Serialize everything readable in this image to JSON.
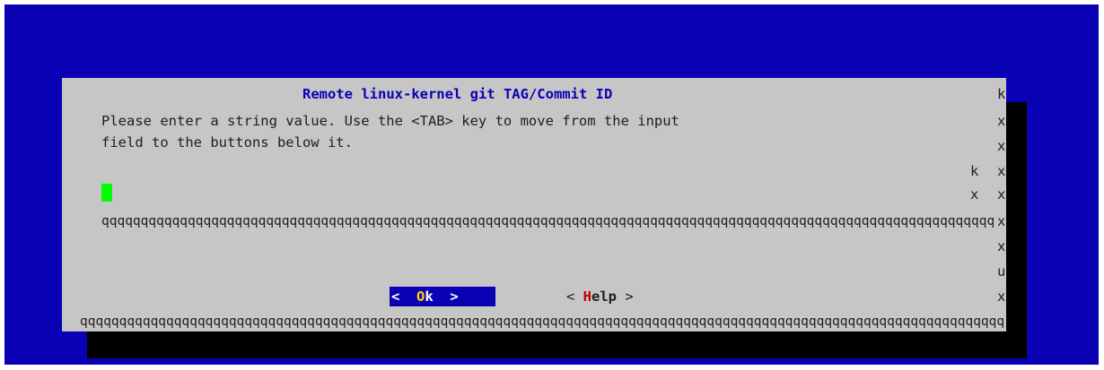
{
  "dialog": {
    "title": "Remote linux-kernel git TAG/Commit ID",
    "prompt_line1": "Please enter a string value. Use the <TAB> key to move from the input",
    "prompt_line2": "field to the buttons below it.",
    "input_value": "",
    "input_bottom_border": "qqqqqqqqqqqqqqqqqqqqqqqqqqqqqqqqqqqqqqqqqqqqqqqqqqqqqqqqqqqqqqqqqqqqqqqqqqqqqqqqqqqqqqqqqqqqqqqqqqqqqqqqqqqqqqqqqqqqqqqqqqqqqqqqqqqqqqqqqqqqqqqqqqqqqqqqqqqqqqqqqqqqqqj",
    "bottom_border": "qqqqqqqqqqqqqqqqqqqqqqqqqqqqqqqqqqqqqqqqqqqqqqqqqqqqqqqqqqqqqqqqqqqqqqqqqqqqqqqqqqqqqqqqqqqqqqqqqqqqqqqqqqqqqqqqqqqqqqqqqqqqqqqqqqqqqqqqqqqqqqqqqqqqqqqqqqqqqqqqqqqqqqqqqqj",
    "right_border_chars": {
      "r0": "k",
      "r1": "x",
      "r2": "x",
      "r3": "x",
      "r4": "x",
      "r5": "x",
      "r6": "x",
      "r7": "u",
      "r8": "x"
    },
    "input_box_chars": {
      "top_right": "k",
      "side": "x"
    }
  },
  "buttons": {
    "ok": {
      "left": "<",
      "hotkey": "O",
      "rest": "k",
      "right": ">"
    },
    "help": {
      "left": "< ",
      "hotkey": "H",
      "rest": "elp",
      "right": " >"
    }
  },
  "colors": {
    "screen_background": "#0a00b4",
    "dialog_background": "#c6c6c6",
    "title_text": "#0a00b4",
    "cursor": "#00ff00",
    "ok_button_background": "#0a00b4",
    "ok_hotkey": "#ffd700",
    "help_hotkey": "#c00000"
  }
}
